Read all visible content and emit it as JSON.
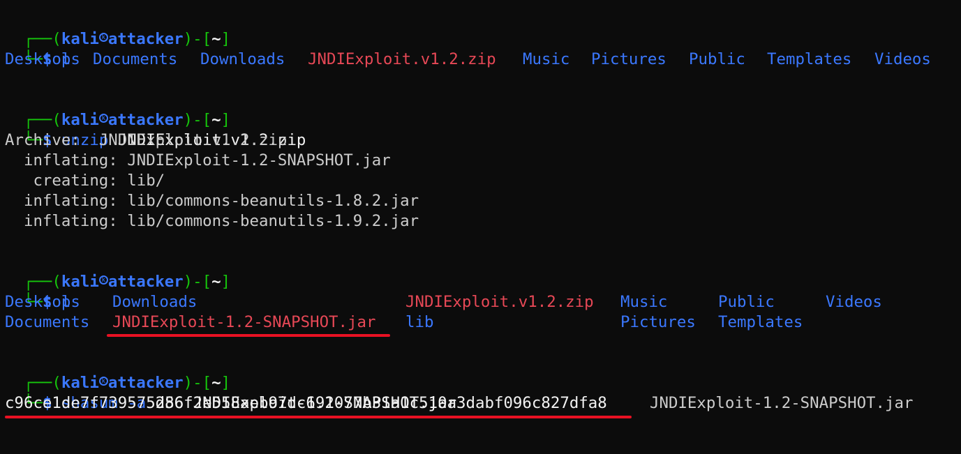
{
  "prompt": {
    "corner_top": "┌──(",
    "user": "kali",
    "separator_glyph": "㉿",
    "host": "attacker",
    "mid": ")-[",
    "dir": "~",
    "close": "]",
    "corner_bottom": "└─",
    "dollar": "$"
  },
  "blocks": [
    {
      "command": "ls",
      "command_args": "",
      "ls_row": [
        "Desktop",
        "Documents",
        "Downloads",
        "JNDIExploit.v1.2.zip",
        "Music",
        "Pictures",
        "Public",
        "Templates",
        "Videos"
      ]
    },
    {
      "command": "unzip",
      "command_args": "JNDIExploit.v1.2.zip",
      "output": [
        "Archive:  JNDIExploit.v1.2.zip",
        "  inflating: JNDIExploit-1.2-SNAPSHOT.jar",
        "   creating: lib/",
        "  inflating: lib/commons-beanutils-1.8.2.jar",
        "  inflating: lib/commons-beanutils-1.9.2.jar"
      ]
    },
    {
      "command": "ls",
      "command_args": "",
      "ls_grid": [
        [
          "Desktop",
          "Downloads",
          "JNDIExploit.v1.2.zip",
          "Music",
          "Public",
          "Videos"
        ],
        [
          "Documents",
          "JNDIExploit-1.2-SNAPSHOT.jar",
          "lib",
          "Pictures",
          "Templates"
        ]
      ]
    },
    {
      "command": "shasum",
      "command_flag": "-a",
      "command_args": "256 JNDIExploit-1.2-SNAPSHOT.jar",
      "hash": "c96ce1de7f739575d86f2e558aeb97dc691077b31a1c510a3dabf096c827dfa8",
      "hash_file": "JNDIExploit-1.2-SNAPSHOT.jar"
    }
  ],
  "colors": {
    "background": "#0c0c0c",
    "prompt_green": "#16c60c",
    "directory_blue": "#3b78ff",
    "archive_red": "#e74856",
    "annotation_underline": "#e81123",
    "output_gray": "#cccccc"
  }
}
